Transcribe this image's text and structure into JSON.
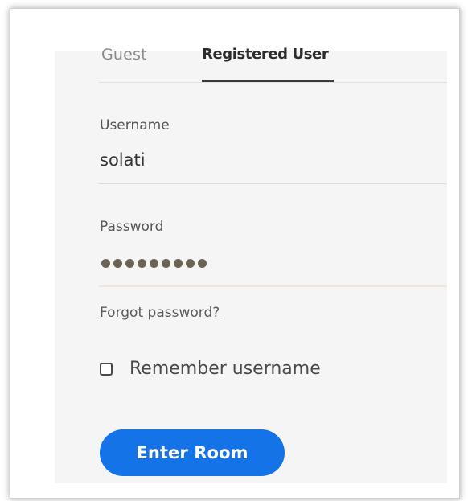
{
  "tabs": [
    {
      "label": "Guest",
      "selected": false
    },
    {
      "label": "Registered User",
      "selected": true
    }
  ],
  "username": {
    "label": "Username",
    "value": "solati"
  },
  "password": {
    "label": "Password",
    "masked_length": 9
  },
  "forgot_password": "Forgot password?",
  "remember_username": {
    "label": "Remember username",
    "checked": false
  },
  "enter_button": "Enter Room",
  "colors": {
    "primary_button": "#1473e6",
    "panel_background": "#f5f5f5"
  }
}
